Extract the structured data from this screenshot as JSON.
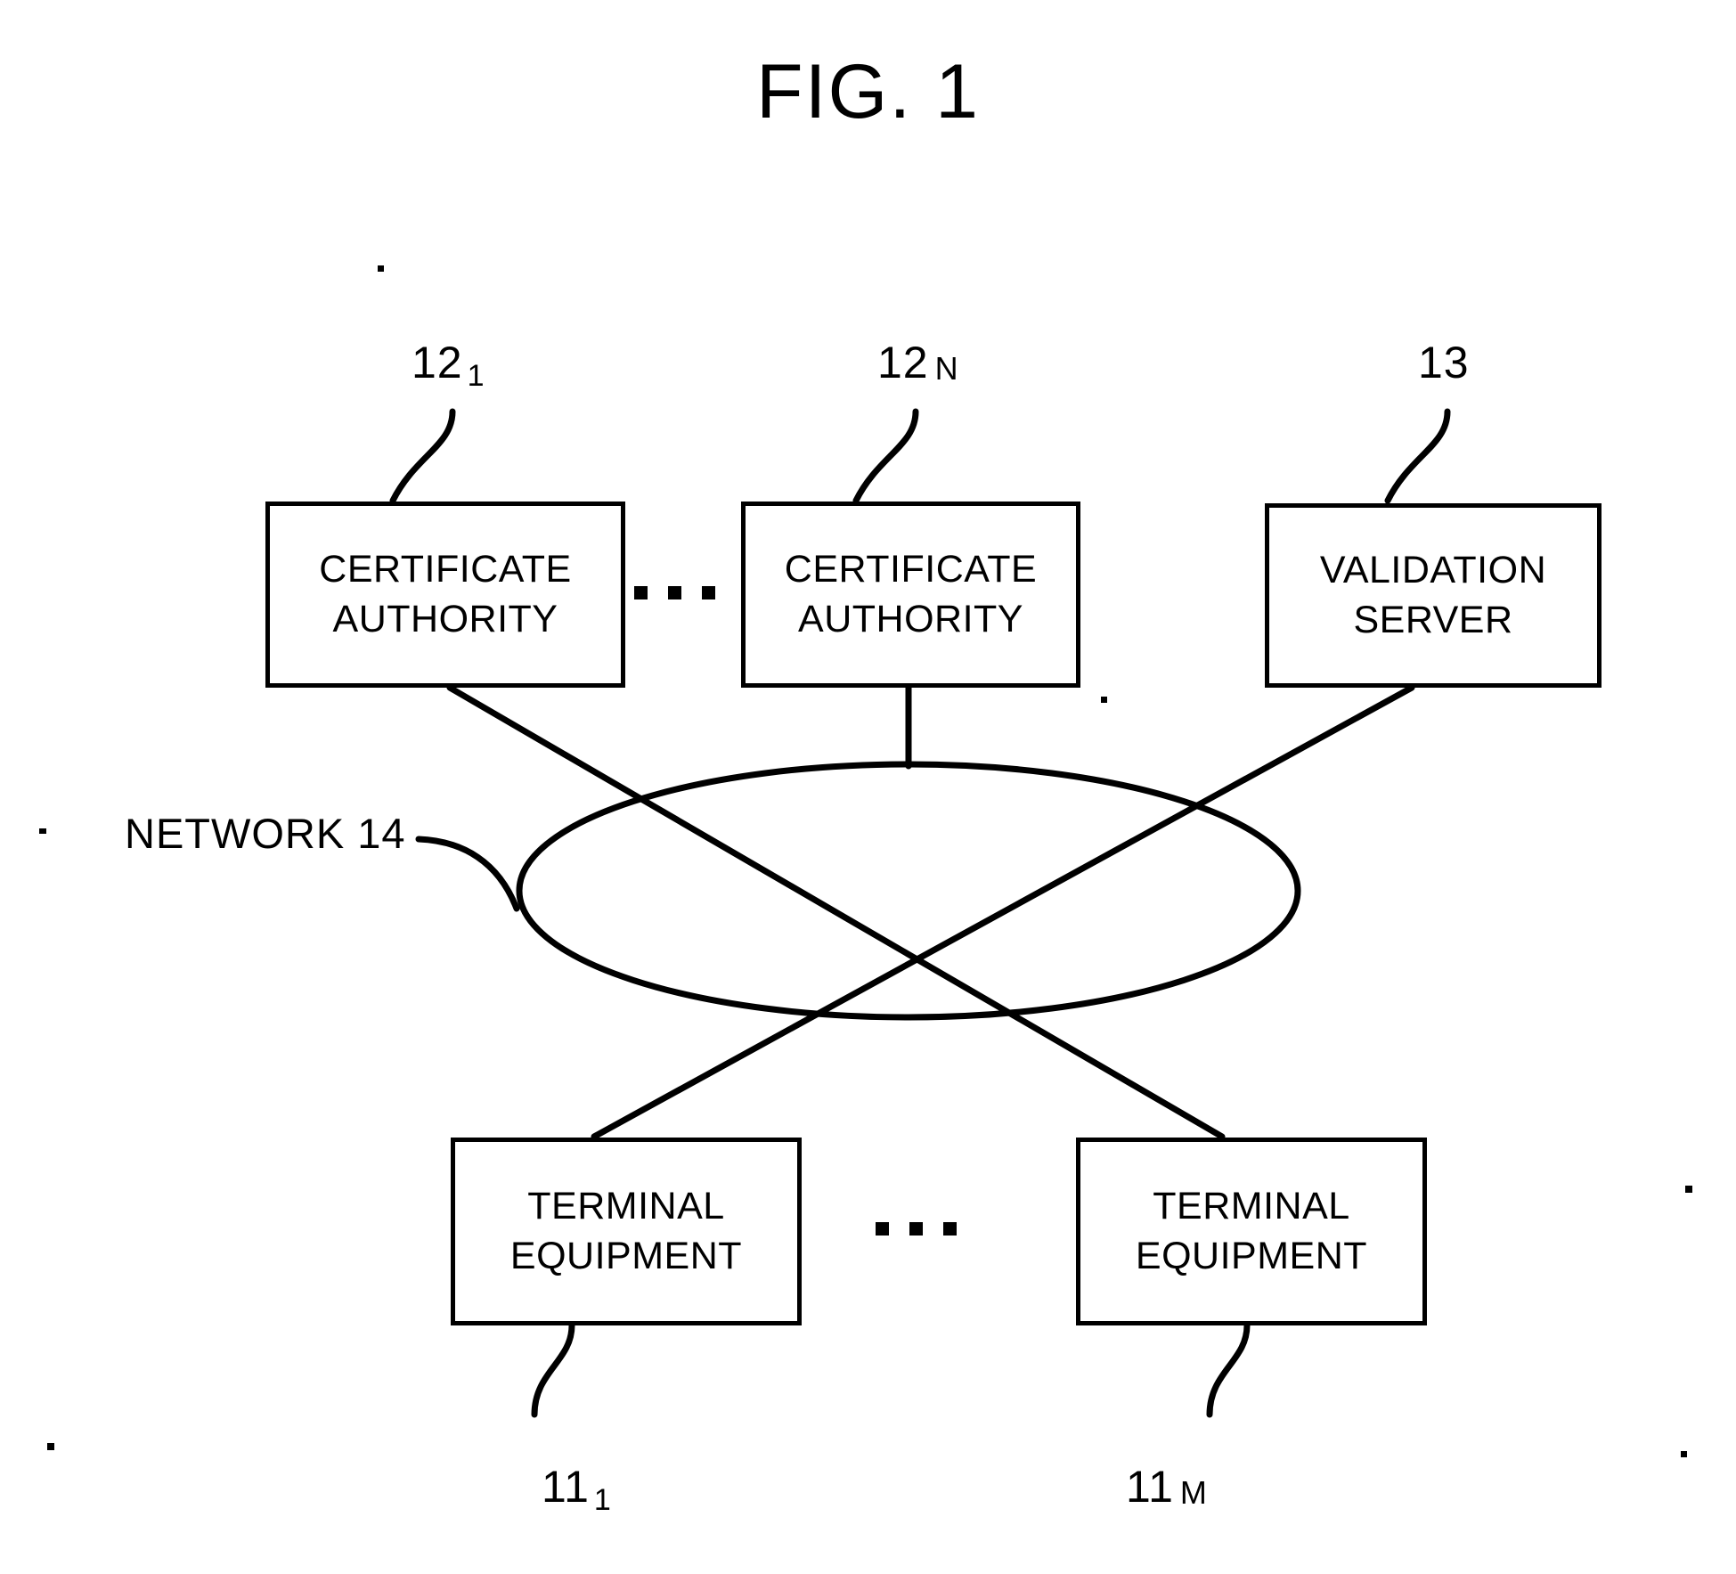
{
  "figure": {
    "title": "FIG. 1",
    "type": "patent-block-diagram"
  },
  "nodes": [
    {
      "id": "certificate-authority-1",
      "line1": "CERTIFICATE",
      "line2": "AUTHORITY",
      "ref": "12",
      "ref_sub": "1"
    },
    {
      "id": "certificate-authority-n",
      "line1": "CERTIFICATE",
      "line2": "AUTHORITY",
      "ref": "12",
      "ref_sub": "N"
    },
    {
      "id": "validation-server",
      "line1": "VALIDATION",
      "line2": "SERVER",
      "ref": "13",
      "ref_sub": ""
    },
    {
      "id": "terminal-equipment-1",
      "line1": "TERMINAL",
      "line2": "EQUIPMENT",
      "ref": "11",
      "ref_sub": "1"
    },
    {
      "id": "terminal-equipment-m",
      "line1": "TERMINAL",
      "line2": "EQUIPMENT",
      "ref": "11",
      "ref_sub": "M"
    }
  ],
  "network": {
    "label": "NETWORK  14",
    "shape": "ellipse"
  },
  "ellipsis": {
    "top": "...",
    "bottom": "..."
  },
  "colors": {
    "stroke": "#000000",
    "background": "#ffffff"
  }
}
